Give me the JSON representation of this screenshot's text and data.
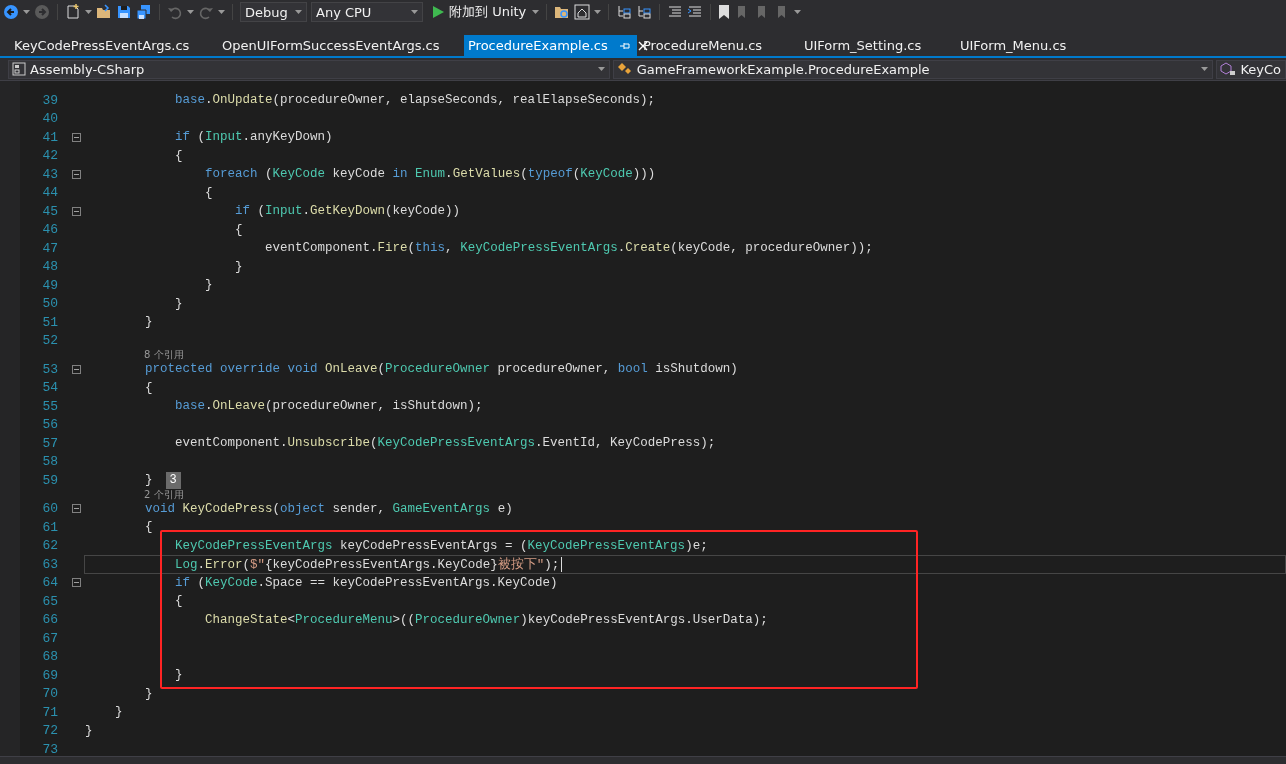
{
  "toolbar": {
    "configuration": "Debug",
    "platform": "Any CPU",
    "run_button": "附加到 Unity"
  },
  "tabs": [
    {
      "label": "KeyCodePressEventArgs.cs",
      "selected": false
    },
    {
      "label": "OpenUIFormSuccessEventArgs.cs",
      "selected": false
    },
    {
      "label": "ProcedureExample.cs",
      "selected": true
    },
    {
      "label": "ProcedureMenu.cs",
      "selected": false
    },
    {
      "label": "UIForm_Setting.cs",
      "selected": false
    },
    {
      "label": "UIForm_Menu.cs",
      "selected": false
    }
  ],
  "navigation": {
    "project": "Assembly-CSharp",
    "type": "GameFrameworkExample.ProcedureExample",
    "member": "KeyCo"
  },
  "editor": {
    "lines": [
      {
        "kind": "code",
        "number": "39",
        "current": false,
        "tokens": [
          {
            "kind": "keyword",
            "text": "            base"
          },
          {
            "kind": "plain",
            "text": "."
          },
          {
            "kind": "method",
            "text": "OnUpdate"
          },
          {
            "kind": "plain",
            "text": "(procedureOwner, elapseSeconds, realElapseSeconds);"
          }
        ]
      },
      {
        "kind": "code",
        "number": "40",
        "current": false
      },
      {
        "kind": "code",
        "number": "41",
        "current": false,
        "expanded": true,
        "tokens": [
          {
            "kind": "keyword",
            "text": "            if"
          },
          {
            "kind": "plain",
            "text": " ("
          },
          {
            "kind": "type",
            "text": "Input"
          },
          {
            "kind": "plain",
            "text": ".anyKeyDown)"
          }
        ]
      },
      {
        "kind": "code",
        "number": "42",
        "current": false,
        "tokens": [
          {
            "kind": "plain",
            "text": "            {"
          }
        ]
      },
      {
        "kind": "code",
        "number": "43",
        "current": false,
        "expanded": true,
        "tokens": [
          {
            "kind": "keyword",
            "text": "                foreach"
          },
          {
            "kind": "plain",
            "text": " ("
          },
          {
            "kind": "type",
            "text": "KeyCode"
          },
          {
            "kind": "plain",
            "text": " keyCode "
          },
          {
            "kind": "keyword",
            "text": "in"
          },
          {
            "kind": "type",
            "text": " Enum"
          },
          {
            "kind": "plain",
            "text": "."
          },
          {
            "kind": "method",
            "text": "GetValues"
          },
          {
            "kind": "plain",
            "text": "("
          },
          {
            "kind": "keyword",
            "text": "typeof"
          },
          {
            "kind": "plain",
            "text": "("
          },
          {
            "kind": "type",
            "text": "KeyCode"
          },
          {
            "kind": "plain",
            "text": ")))"
          }
        ]
      },
      {
        "kind": "code",
        "number": "44",
        "current": false,
        "tokens": [
          {
            "kind": "plain",
            "text": "                {"
          }
        ]
      },
      {
        "kind": "code",
        "number": "45",
        "current": false,
        "expanded": true,
        "tokens": [
          {
            "kind": "keyword",
            "text": "                    if"
          },
          {
            "kind": "plain",
            "text": " ("
          },
          {
            "kind": "type",
            "text": "Input"
          },
          {
            "kind": "plain",
            "text": "."
          },
          {
            "kind": "method",
            "text": "GetKeyDown"
          },
          {
            "kind": "plain",
            "text": "(keyCode))"
          }
        ]
      },
      {
        "kind": "code",
        "number": "46",
        "current": false,
        "tokens": [
          {
            "kind": "plain",
            "text": "                    {"
          }
        ]
      },
      {
        "kind": "code",
        "number": "47",
        "current": false,
        "tokens": [
          {
            "kind": "plain",
            "text": "                        eventComponent."
          },
          {
            "kind": "method",
            "text": "Fire"
          },
          {
            "kind": "plain",
            "text": "("
          },
          {
            "kind": "keyword",
            "text": "this"
          },
          {
            "kind": "plain",
            "text": ", "
          },
          {
            "kind": "type",
            "text": "KeyCodePressEventArgs"
          },
          {
            "kind": "plain",
            "text": "."
          },
          {
            "kind": "method",
            "text": "Create"
          },
          {
            "kind": "plain",
            "text": "(keyCode, procedureOwner));"
          }
        ]
      },
      {
        "kind": "code",
        "number": "48",
        "current": false,
        "tokens": [
          {
            "kind": "plain",
            "text": "                    }"
          }
        ]
      },
      {
        "kind": "code",
        "number": "49",
        "current": false,
        "tokens": [
          {
            "kind": "plain",
            "text": "                }"
          }
        ]
      },
      {
        "kind": "code",
        "number": "50",
        "current": false,
        "tokens": [
          {
            "kind": "plain",
            "text": "            }"
          }
        ]
      },
      {
        "kind": "code",
        "number": "51",
        "current": false,
        "tokens": [
          {
            "kind": "plain",
            "text": "        }"
          }
        ]
      },
      {
        "kind": "code",
        "number": "52",
        "current": false
      },
      {
        "kind": "lens",
        "text": "8 个引用"
      },
      {
        "kind": "code",
        "number": "53",
        "current": false,
        "expanded": true,
        "tokens": [
          {
            "kind": "keyword",
            "text": "        protected override void"
          },
          {
            "kind": "method",
            "text": " OnLeave"
          },
          {
            "kind": "plain",
            "text": "("
          },
          {
            "kind": "type",
            "text": "ProcedureOwner"
          },
          {
            "kind": "plain",
            "text": " procedureOwner, "
          },
          {
            "kind": "keyword",
            "text": "bool"
          },
          {
            "kind": "plain",
            "text": " isShutdown)"
          }
        ]
      },
      {
        "kind": "code",
        "number": "54",
        "current": false,
        "tokens": [
          {
            "kind": "plain",
            "text": "        {"
          }
        ]
      },
      {
        "kind": "code",
        "number": "55",
        "current": false,
        "tokens": [
          {
            "kind": "keyword",
            "text": "            base"
          },
          {
            "kind": "plain",
            "text": "."
          },
          {
            "kind": "method",
            "text": "OnLeave"
          },
          {
            "kind": "plain",
            "text": "(procedureOwner, isShutdown);"
          }
        ]
      },
      {
        "kind": "code",
        "number": "56",
        "current": false
      },
      {
        "kind": "code",
        "number": "57",
        "current": false,
        "tokens": [
          {
            "kind": "plain",
            "text": "            eventComponent."
          },
          {
            "kind": "method",
            "text": "Unsubscribe"
          },
          {
            "kind": "plain",
            "text": "("
          },
          {
            "kind": "type",
            "text": "KeyCodePressEventArgs"
          },
          {
            "kind": "plain",
            "text": ".EventId, KeyCodePress);"
          }
        ]
      },
      {
        "kind": "code",
        "number": "58",
        "current": false
      },
      {
        "kind": "code",
        "number": "59",
        "current": false,
        "badge": "3",
        "tokens": [
          {
            "kind": "plain",
            "text": "        }"
          }
        ]
      },
      {
        "kind": "lens",
        "text": "2 个引用"
      },
      {
        "kind": "code",
        "number": "60",
        "current": false,
        "expanded": true,
        "tokens": [
          {
            "kind": "keyword",
            "text": "        void"
          },
          {
            "kind": "method",
            "text": " KeyCodePress"
          },
          {
            "kind": "plain",
            "text": "("
          },
          {
            "kind": "keyword",
            "text": "object"
          },
          {
            "kind": "plain",
            "text": " sender, "
          },
          {
            "kind": "type",
            "text": "GameEventArgs"
          },
          {
            "kind": "plain",
            "text": " e)"
          }
        ]
      },
      {
        "kind": "code",
        "number": "61",
        "current": false,
        "tokens": [
          {
            "kind": "plain",
            "text": "        {"
          }
        ]
      },
      {
        "kind": "code",
        "number": "62",
        "current": false,
        "tokens": [
          {
            "kind": "type",
            "text": "            KeyCodePressEventArgs"
          },
          {
            "kind": "plain",
            "text": " keyCodePressEventArgs = ("
          },
          {
            "kind": "type",
            "text": "KeyCodePressEventArgs"
          },
          {
            "kind": "plain",
            "text": ")e;"
          }
        ]
      },
      {
        "kind": "code",
        "number": "63",
        "current": true,
        "tokens": [
          {
            "kind": "type",
            "text": "            Log"
          },
          {
            "kind": "plain",
            "text": "."
          },
          {
            "kind": "method",
            "text": "Error"
          },
          {
            "kind": "plain",
            "text": "("
          },
          {
            "kind": "string",
            "text": "$\""
          },
          {
            "kind": "plain",
            "text": "{keyCodePressEventArgs.KeyCode}"
          },
          {
            "kind": "string",
            "text": "被按下\""
          },
          {
            "kind": "plain",
            "text": ");"
          }
        ]
      },
      {
        "kind": "code",
        "number": "64",
        "current": false,
        "expanded": true,
        "tokens": [
          {
            "kind": "keyword",
            "text": "            if"
          },
          {
            "kind": "plain",
            "text": " ("
          },
          {
            "kind": "type",
            "text": "KeyCode"
          },
          {
            "kind": "plain",
            "text": ".Space == keyCodePressEventArgs.KeyCode)"
          }
        ]
      },
      {
        "kind": "code",
        "number": "65",
        "current": false,
        "tokens": [
          {
            "kind": "plain",
            "text": "            {"
          }
        ]
      },
      {
        "kind": "code",
        "number": "66",
        "current": false,
        "tokens": [
          {
            "kind": "method",
            "text": "                ChangeState"
          },
          {
            "kind": "plain",
            "text": "<"
          },
          {
            "kind": "type",
            "text": "ProcedureMenu"
          },
          {
            "kind": "plain",
            "text": ">(("
          },
          {
            "kind": "type",
            "text": "ProcedureOwner"
          },
          {
            "kind": "plain",
            "text": ")keyCodePressEventArgs.UserData);"
          }
        ]
      },
      {
        "kind": "code",
        "number": "67",
        "current": false
      },
      {
        "kind": "code",
        "number": "68",
        "current": false
      },
      {
        "kind": "code",
        "number": "69",
        "current": false,
        "tokens": [
          {
            "kind": "plain",
            "text": "            }"
          }
        ]
      },
      {
        "kind": "code",
        "number": "70",
        "current": false,
        "tokens": [
          {
            "kind": "plain",
            "text": "        }"
          }
        ]
      },
      {
        "kind": "code",
        "number": "71",
        "current": false,
        "tokens": [
          {
            "kind": "plain",
            "text": "    }"
          }
        ]
      },
      {
        "kind": "code",
        "number": "72",
        "current": false,
        "tokens": [
          {
            "kind": "plain",
            "text": "}"
          }
        ]
      },
      {
        "kind": "code",
        "number": "73",
        "current": false
      }
    ]
  }
}
